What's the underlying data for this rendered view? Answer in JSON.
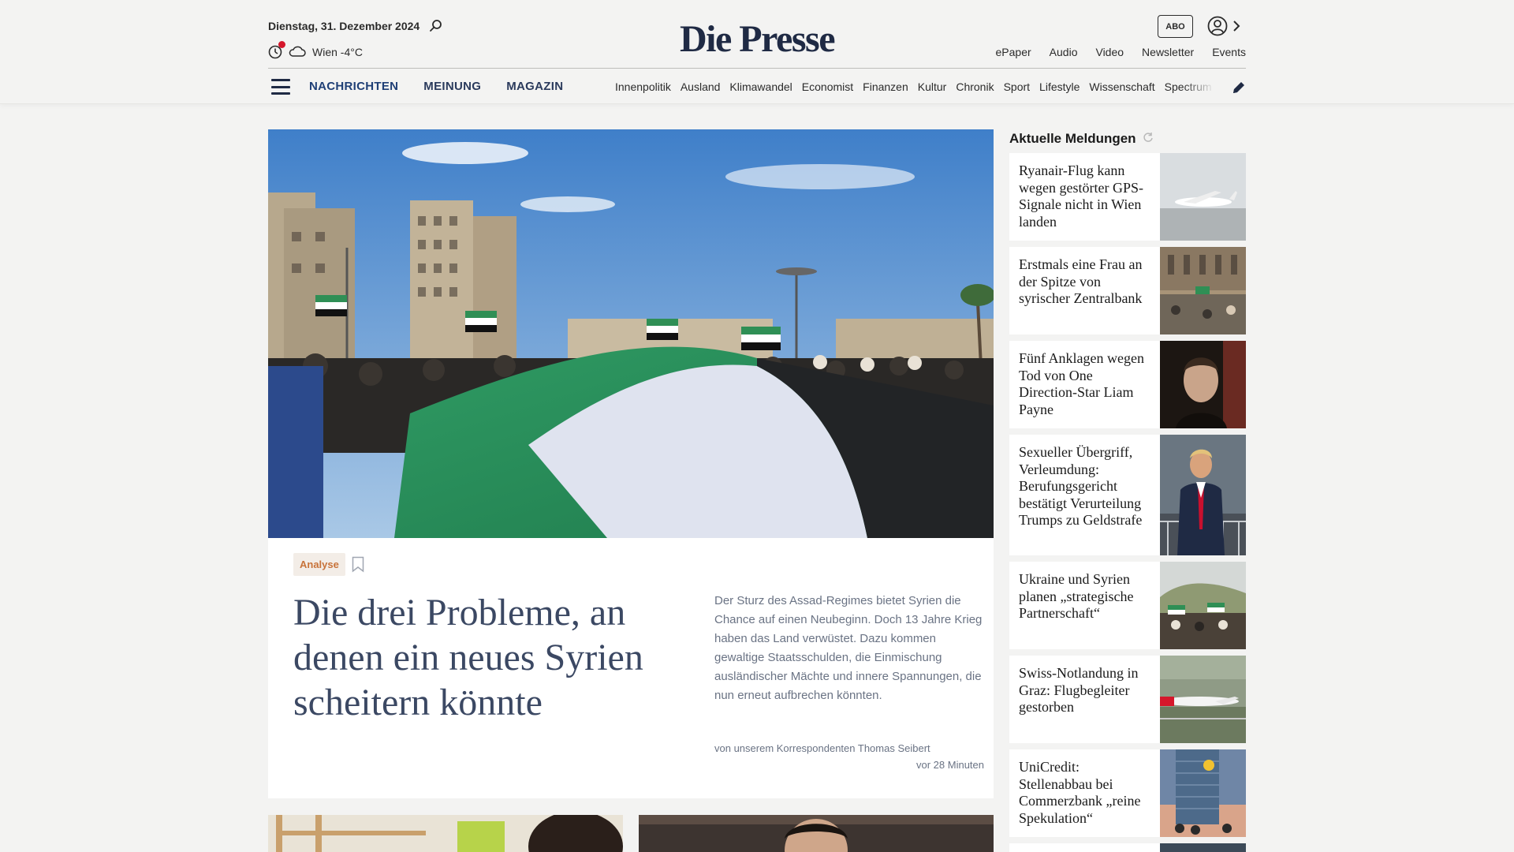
{
  "header": {
    "date": "Dienstag, 31. Dezember 2024",
    "weather": "Wien -4°C",
    "logo": "Die Presse",
    "abo_label": "ABO",
    "service_nav": [
      "ePaper",
      "Audio",
      "Video",
      "Newsletter",
      "Events"
    ],
    "main_nav": [
      "NACHRICHTEN",
      "MEINUNG",
      "MAGAZIN"
    ],
    "sub_nav": [
      "Innenpolitik",
      "Ausland",
      "Klimawandel",
      "Economist",
      "Finanzen",
      "Kultur",
      "Chronik",
      "Sport",
      "Lifestyle",
      "Wissenschaft",
      "Spectrum"
    ]
  },
  "hero": {
    "tag": "Analyse",
    "title": "Die drei Probleme, an denen ein neues Syrien scheitern könnte",
    "lead": "Der Sturz des Assad-Regimes bietet Syrien die Chance auf einen Neubeginn. Doch 13 Jahre Krieg haben das Land verwüstet. Dazu kommen gewaltige Staatsschulden, die Einmischung ausländischer Mächte und innere Spannungen, die nun erneut aufbrechen könnten.",
    "byline": "von unserem Korrespondenten Thomas Seibert",
    "time": "vor 28 Minuten"
  },
  "sidebar": {
    "title": "Aktuelle Meldungen",
    "items": [
      {
        "headline": "Ryanair-Flug kann wegen gestörter GPS-Signale nicht in Wien landen",
        "image": "airplane-on-runway"
      },
      {
        "headline": "Erstmals eine Frau an der Spitze von syrischer Zentralbank",
        "image": "crowd-in-square"
      },
      {
        "headline": "Fünf Anklagen wegen Tod von One Direction-Star Liam Payne",
        "image": "portrait"
      },
      {
        "headline": "Sexueller Übergriff, Verleumdung: Berufungsgericht bestätigt Verurteilung Trumps zu Geldstrafe",
        "image": "man-in-suit"
      },
      {
        "headline": "Ukraine und Syrien planen „strategische Partnerschaft“",
        "image": "crowd-with-flags"
      },
      {
        "headline": "Swiss-Notlandung in Graz: Flugbegleiter gestorben",
        "image": "swiss-airplane"
      },
      {
        "headline": "UniCredit: Stellenabbau bei Commerzbank „reine Spekulation“",
        "image": "commerzbank-tower"
      }
    ]
  },
  "colors": {
    "accent_navy": "#1f2a44",
    "tag_orange": "#c8733a",
    "alert_red": "#d5172b",
    "background": "#f3f3f2"
  }
}
